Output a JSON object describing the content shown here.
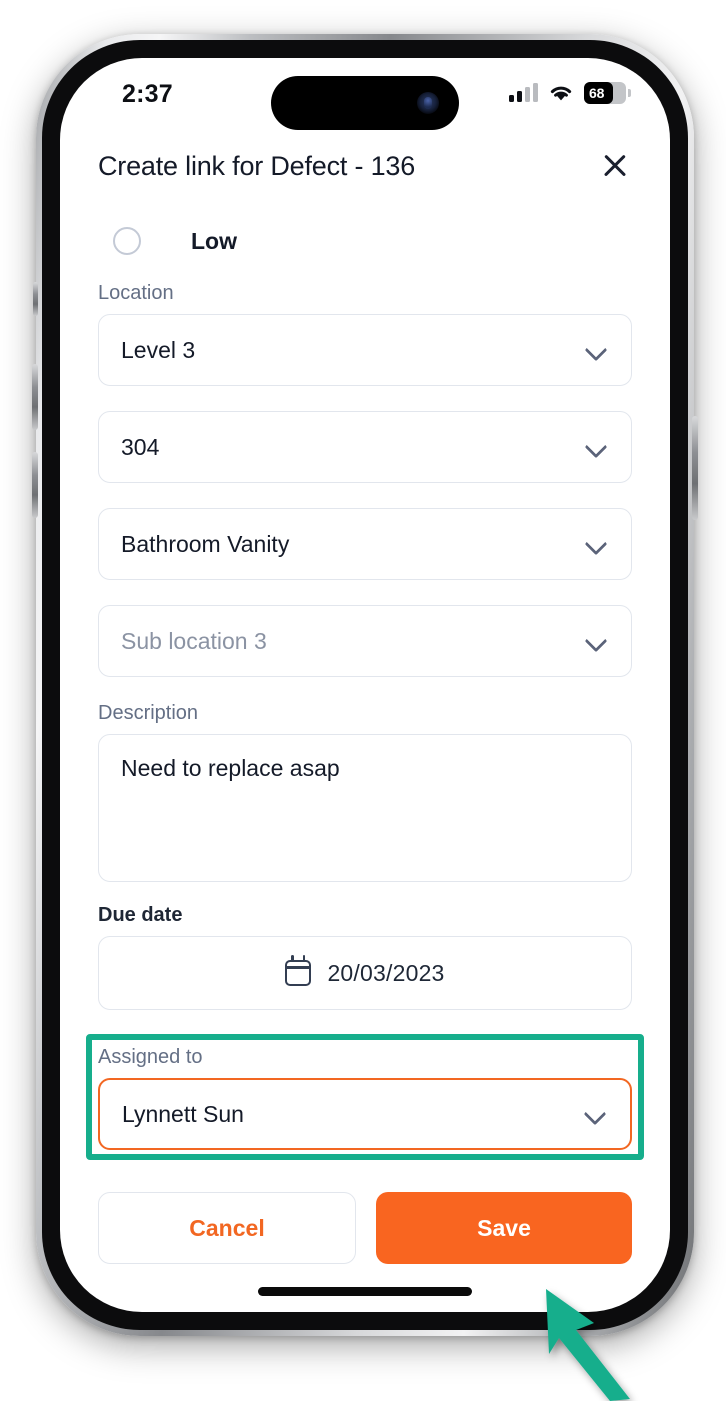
{
  "status_bar": {
    "time": "2:37",
    "battery_level": "68",
    "signal_icon": "cellular-signal-icon",
    "wifi_icon": "wifi-icon",
    "battery_icon": "battery-icon"
  },
  "header": {
    "title": "Create link for Defect - 136",
    "close_icon": "close-icon"
  },
  "priority": {
    "option_label": "Low",
    "selected": false
  },
  "location": {
    "label": "Location",
    "fields": [
      {
        "name": "level",
        "value": "Level 3",
        "is_placeholder": false
      },
      {
        "name": "room",
        "value": "304",
        "is_placeholder": false
      },
      {
        "name": "sub_location_2",
        "value": "Bathroom Vanity",
        "is_placeholder": false
      },
      {
        "name": "sub_location_3",
        "value": "Sub location 3",
        "is_placeholder": true
      }
    ]
  },
  "description": {
    "label": "Description",
    "value": "Need to replace asap"
  },
  "due_date": {
    "label": "Due date",
    "value": "20/03/2023",
    "icon": "calendar-icon"
  },
  "assigned_to": {
    "label": "Assigned to",
    "value": "Lynnett Sun",
    "focused": true,
    "highlighted": true
  },
  "footer": {
    "cancel_label": "Cancel",
    "save_label": "Save"
  },
  "colors": {
    "accent_orange": "#F96520",
    "cancel_text": "#F26722",
    "annotation_teal": "#16AE8C",
    "field_border": "#E2E6ED",
    "label_gray": "#646F85",
    "text_dark": "#141A28"
  },
  "annotations": {
    "highlight_target": "assigned-to-field",
    "arrow_target": "save-button",
    "arrow_color": "#16AE8C"
  }
}
